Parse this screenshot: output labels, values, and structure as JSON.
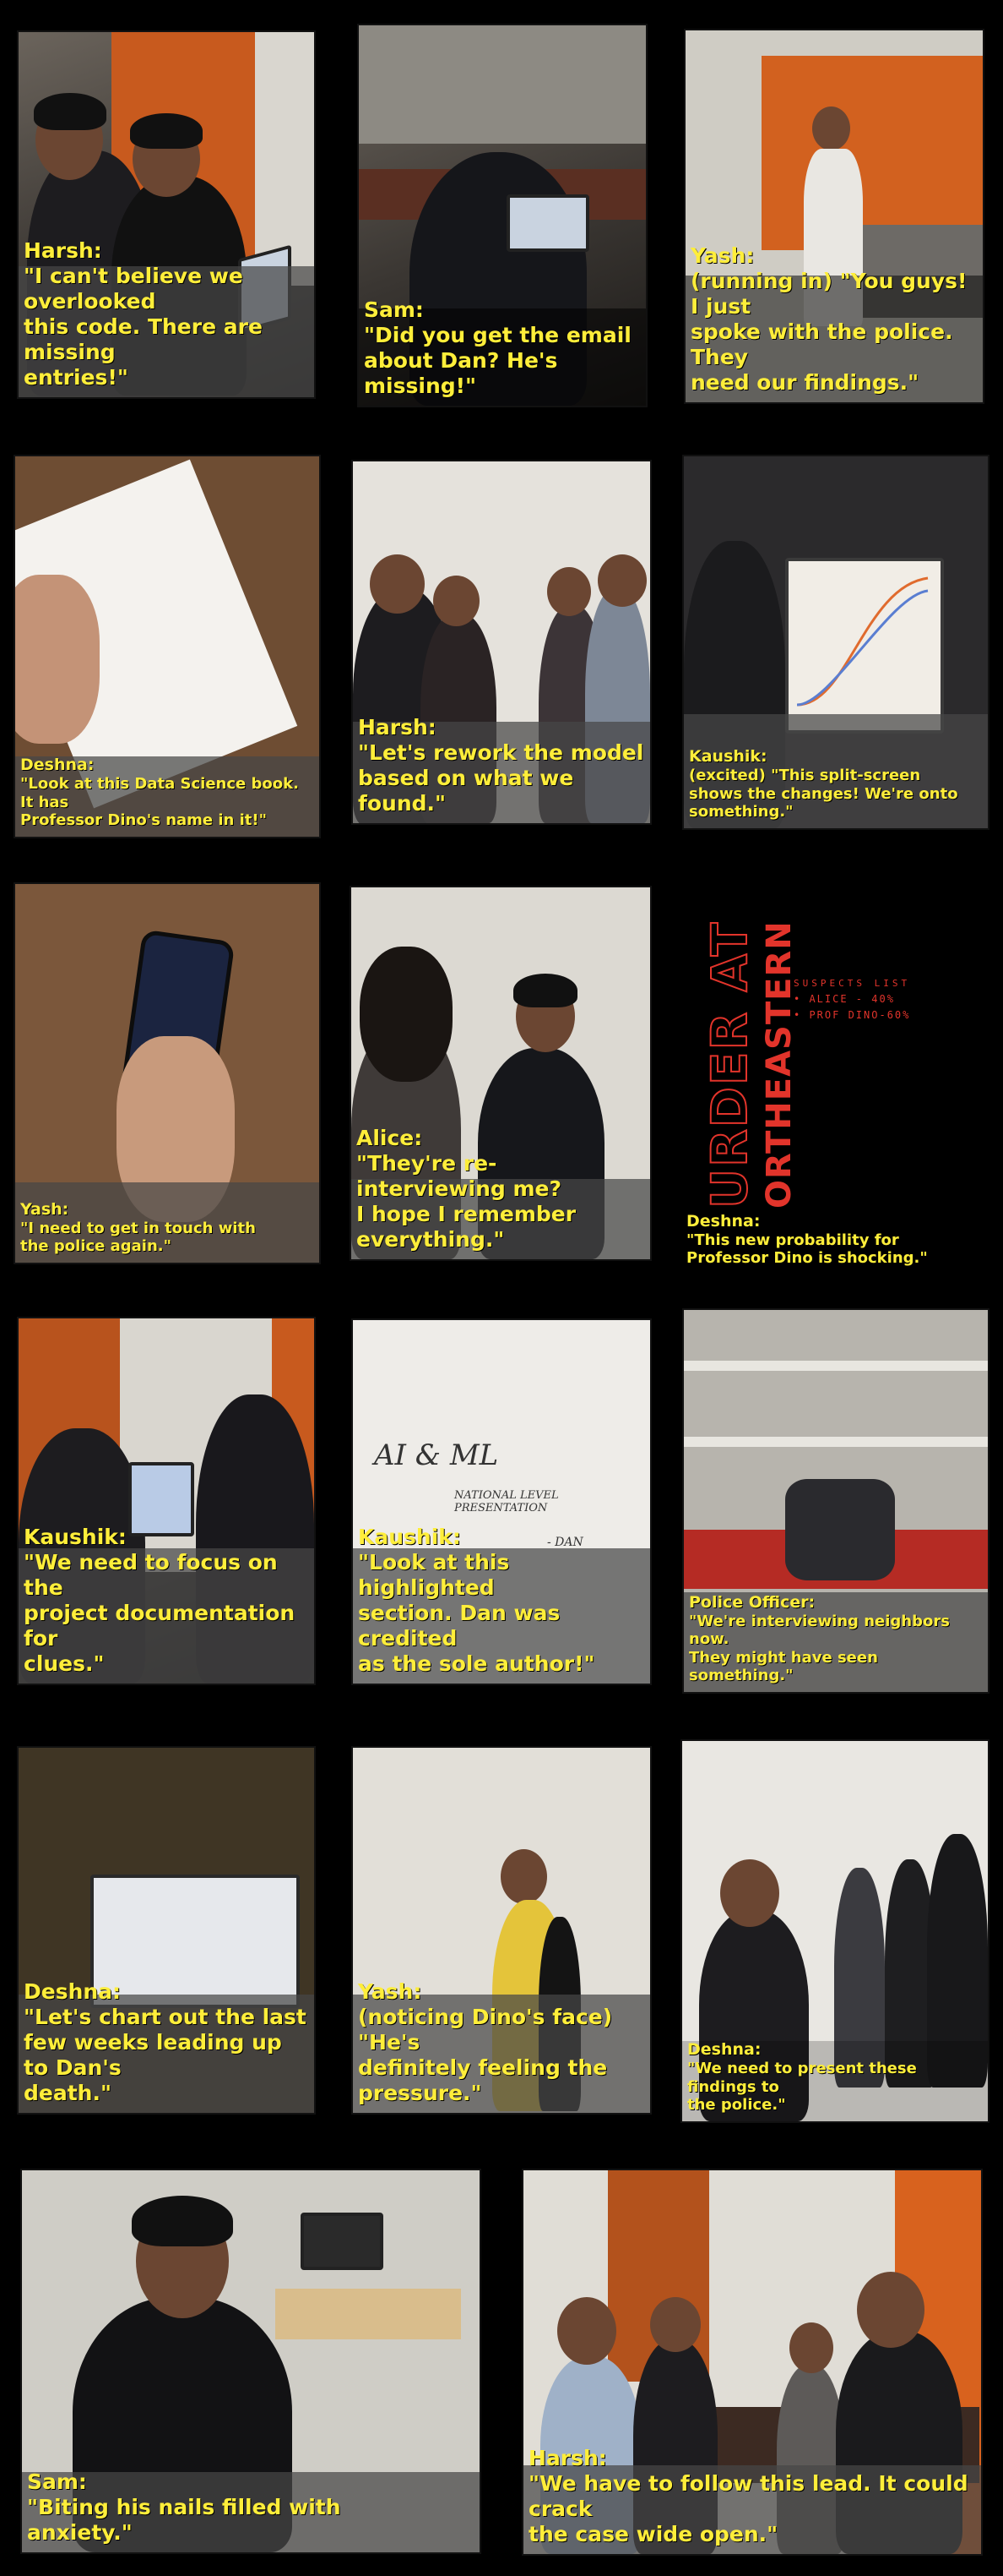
{
  "panels": [
    {
      "speaker": "Harsh:",
      "text": "\"I can't believe we overlooked\nthis code. There are missing\nentries!\""
    },
    {
      "speaker": "Sam:",
      "text": "\"Did you get the email\nabout Dan? He's\nmissing!\""
    },
    {
      "speaker": "Yash:",
      "text": "(running in) \"You guys! I just\nspoke with the police. They\nneed our findings.\""
    },
    {
      "speaker": "Deshna:",
      "text": "\"Look at this Data Science book. It has\nProfessor Dino's name in it!\""
    },
    {
      "speaker": "Harsh:",
      "text": "\"Let's rework the model\nbased on what we found.\""
    },
    {
      "speaker": "Kaushik:",
      "text": "(excited) \"This split-screen\nshows the changes! We're onto\nsomething.\""
    },
    {
      "speaker": "Yash:",
      "text": "\"I need to get in touch with\nthe police again.\""
    },
    {
      "speaker": "Alice:",
      "text": "\"They're re-interviewing me?\nI hope I remember everything.\""
    },
    {
      "speaker": "Deshna:",
      "text": "\"This new probability for\nProfessor Dino is shocking.\""
    },
    {
      "speaker": "Kaushik:",
      "text": "\"We need to focus on the\nproject documentation for\nclues.\""
    },
    {
      "speaker": "Kaushik:",
      "text": "\"Look at this highlighted\nsection. Dan was credited\nas the sole author!\""
    },
    {
      "speaker": "Police Officer:",
      "text": "\"We're interviewing neighbors now.\nThey might have seen something.\""
    },
    {
      "speaker": "Deshna:",
      "text": "\"Let's chart out the last\nfew weeks leading up to Dan's\ndeath.\""
    },
    {
      "speaker": "Yash:",
      "text": "(noticing Dino's face) \"He's\ndefinitely feeling the\npressure.\""
    },
    {
      "speaker": "Deshna:",
      "text": "\"We need to present these findings to\nthe police.\""
    },
    {
      "speaker": "Sam:",
      "text": "\"Biting his nails filled with\nanxiety.\""
    },
    {
      "speaker": "Harsh:",
      "text": "\"We have to follow this lead. It could crack\nthe case wide open.\""
    }
  ],
  "title_card": {
    "line1": "URDER AT",
    "line2": "ORTHEASTERN",
    "suspects_header": "SUSPECTS LIST",
    "suspects": [
      "• ALICE - 40%",
      "• PROF DINO-60%"
    ]
  },
  "whiteboard": {
    "line1": "AI & ML",
    "line2": "NATIONAL LEVEL PRESENTATION",
    "signature": "- DAN"
  },
  "colors": {
    "caption": "#ffee3a",
    "title_red": "#e2342b",
    "background": "#000000"
  }
}
